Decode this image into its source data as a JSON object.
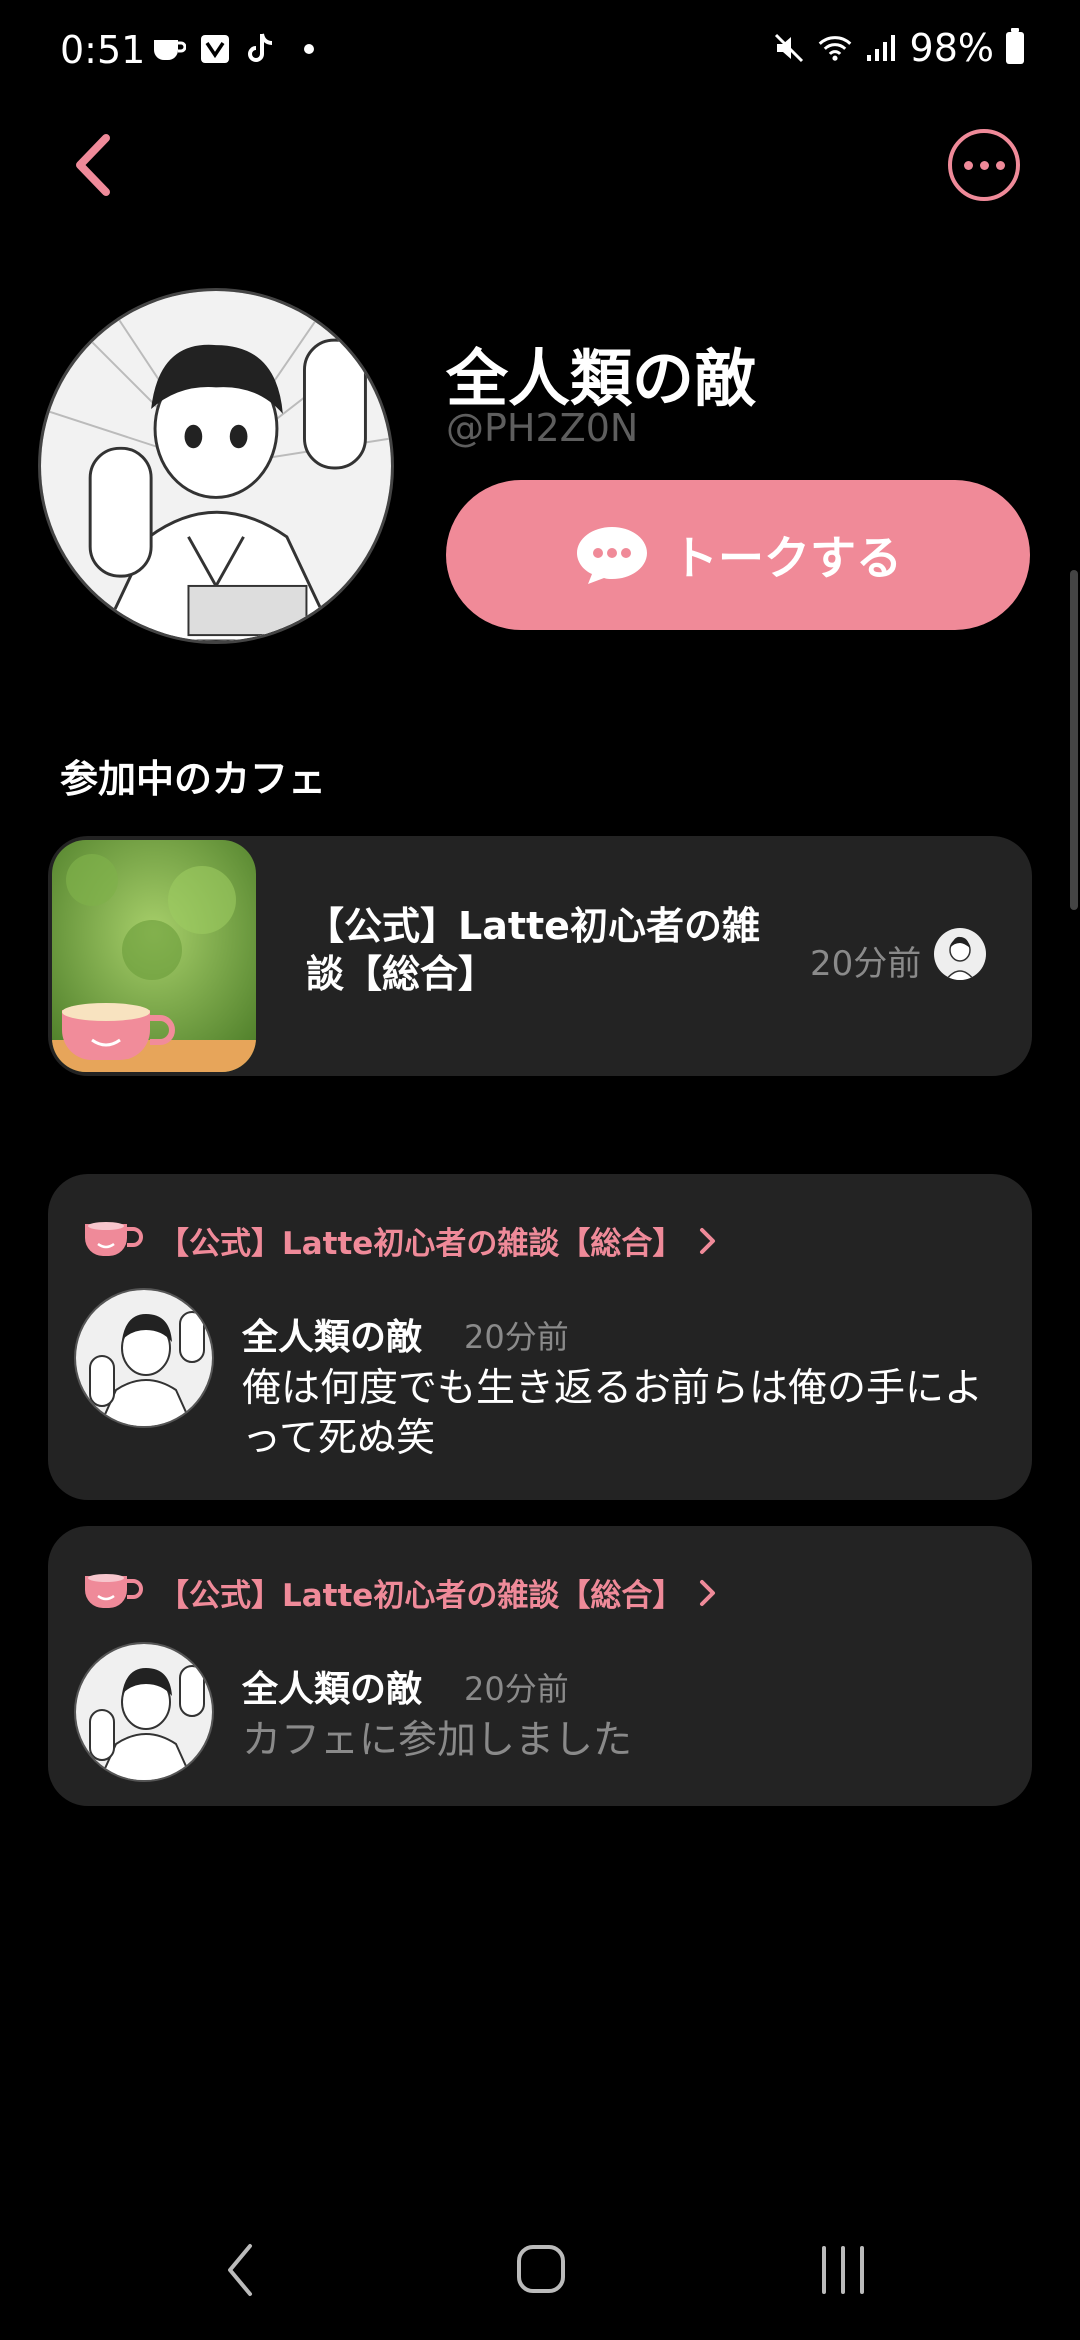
{
  "status_bar": {
    "time": "0:51",
    "battery": "98%",
    "left_icons": [
      "coffee-icon",
      "tray-icon",
      "tiktok-icon",
      "dot"
    ],
    "right_icons": [
      "mute-icon",
      "wifi-icon",
      "signal-icon",
      "battery-icon"
    ]
  },
  "header": {
    "back_icon": "chevron-left-icon",
    "more_icon": "more-horizontal-icon"
  },
  "profile": {
    "name": "全人類の敵",
    "handle": "@PH2Z0N",
    "talk_button": "トークする"
  },
  "section": {
    "title": "参加中のカフェ"
  },
  "cafe": {
    "name_line1": "【公式】Latte初心者の雑",
    "name_line2": "談【総合】",
    "time": "20分前"
  },
  "feed": [
    {
      "cafe_label": "【公式】Latte初心者の雑談【総合】",
      "author": "全人類の敵",
      "time": "20分前",
      "line1": "俺は何度でも生き返るお前らは俺の手によ",
      "line2": "って死ぬ笑"
    },
    {
      "cafe_label": "【公式】Latte初心者の雑談【総合】",
      "author": "全人類の敵",
      "time": "20分前",
      "line1": "カフェに参加しました"
    }
  ],
  "colors": {
    "accent": "#ef8a99",
    "button": "#f08a98",
    "card": "#232323",
    "muted": "#8a8a8a",
    "background": "#000000"
  }
}
